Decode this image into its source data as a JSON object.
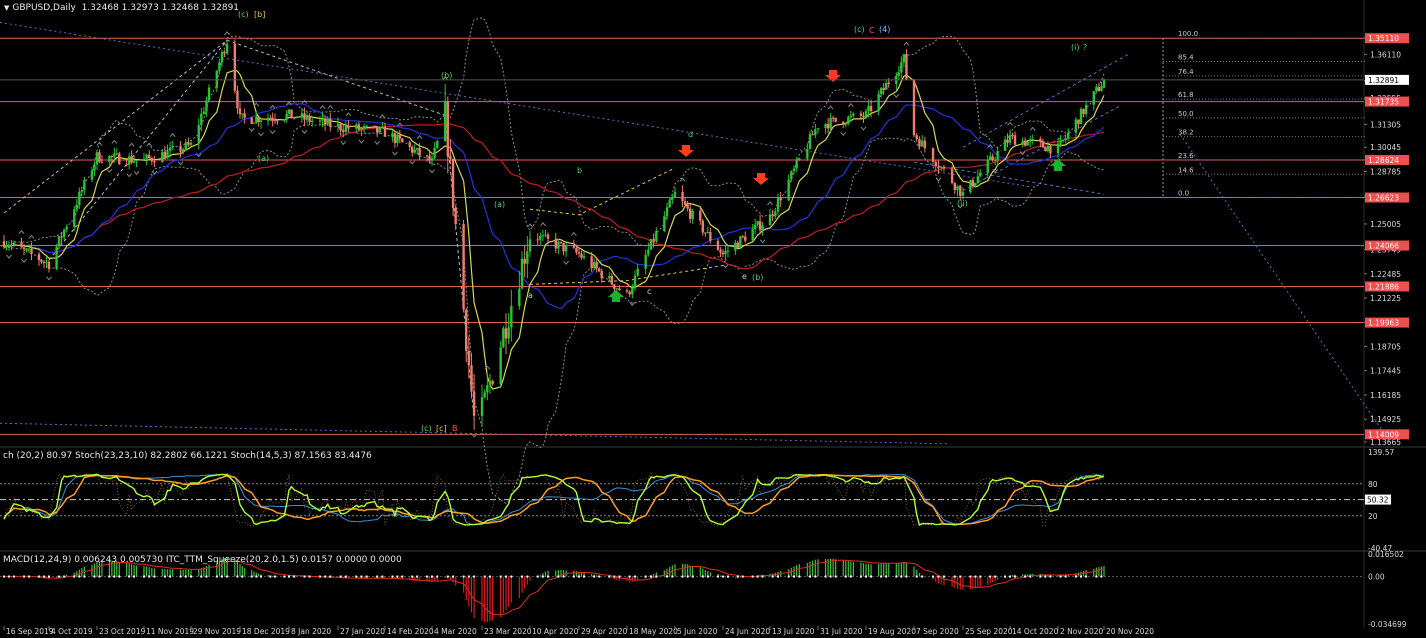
{
  "header": {
    "symbol_label": "GBPUSD,Daily",
    "ohlc": "1.32468 1.32973 1.32468 1.32891"
  },
  "colors": {
    "background": "#000000",
    "bull": "#29c431",
    "bear": "#f07c6c",
    "sr_line": "#e05d5d",
    "price_label_bg": "#ef4f4f",
    "last_price_bg": "#ffffff",
    "ma_yellow": "#d8d84a",
    "ma_blue": "#2233dd",
    "ma_red": "#c21e1e",
    "band": "#8c8c8c",
    "trend_blue": "#5a6fc0",
    "wave_green": "#4fd66a",
    "wave_red": "#ff5050",
    "fib": "#aaaaaa",
    "stoch_green": "#adff2f",
    "stoch_orange": "#ff9d1c",
    "stoch_blue": "#3a8fd8",
    "macd_green": "#40c040",
    "macd_red": "#e01919",
    "macd_signal": "#e0301e",
    "arrow_red": "#ff3c1f",
    "arrow_green": "#19b42c"
  },
  "axis": {
    "price_ticks": [
      "1.36110",
      "1.33802",
      "1.32555",
      "1.31305",
      "1.30045",
      "1.28785",
      "1.26525",
      "1.25005",
      "1.23745",
      "1.22485",
      "1.21225",
      "1.19965",
      "1.18705",
      "1.17445",
      "1.16185",
      "1.14925",
      "1.13665"
    ],
    "sr_labels": [
      "1.35110",
      "1.31735",
      "1.28624",
      "1.26623",
      "1.24066",
      "1.21886",
      "1.19963",
      "1.14009"
    ],
    "last_price": "1.32891",
    "date_labels": [
      "16 Sep 2019",
      "4 Oct 2019",
      "23 Oct 2019",
      "11 Nov 2019",
      "29 Nov 2019",
      "18 Dec 2019",
      "8 Jan 2020",
      "27 Jan 2020",
      "14 Feb 2020",
      "4 Mar 2020",
      "23 Mar 2020",
      "10 Apr 2020",
      "29 Apr 2020",
      "18 May 2020",
      "5 Jun 2020",
      "24 Jun 2020",
      "13 Jul 2020",
      "31 Jul 2020",
      "19 Aug 2020",
      "7 Sep 2020",
      "25 Sep 2020",
      "14 Oct 2020",
      "2 Nov 2020",
      "20 Nov 2020"
    ]
  },
  "fib_levels": [
    "100.0",
    "85.4",
    "76.4",
    "61.8",
    "50.0",
    "38.2",
    "23.6",
    "14.6",
    "0.0"
  ],
  "wave_labels": [
    "(c)",
    "[b]",
    "(b)",
    "(a)",
    "(a)",
    "b",
    "d",
    "a",
    "c",
    "e",
    "(b)",
    "(c)",
    "C",
    "(4)",
    "(i)",
    "?",
    "(ii)",
    "(c)",
    "[c]",
    "B"
  ],
  "stoch": {
    "header": "ch (20,2) 80.97  Stoch(23,23,10) 82.2802 66.1221  Stoch(14,5,3) 87.1563 83.4476",
    "axis_labels": [
      "139.57",
      "80",
      "50.32",
      "20",
      "-40.47"
    ]
  },
  "macd": {
    "header": "MACD(12,24,9) 0.006243 0.005730  ITC_TTM_Squeeze(20,2.0,1.5) 0.0157 0.0000 0.0000",
    "axis_labels": [
      "0.016502",
      "0.00",
      "-0.034699"
    ]
  },
  "chart_data": {
    "type": "candlestick",
    "symbol": "GBPUSD",
    "timeframe": "Daily",
    "x_range": [
      "16 Sep 2019",
      "20 Nov 2020"
    ],
    "ylim": [
      1.136,
      1.364
    ],
    "ohlc_last": {
      "open": 1.32468,
      "high": 1.32973,
      "low": 1.32468,
      "close": 1.32891
    },
    "close_path": [
      [
        "16 Sep 2019",
        1.243
      ],
      [
        "4 Oct 2019",
        1.231
      ],
      [
        "23 Oct 2019",
        1.288
      ],
      [
        "11 Nov 2019",
        1.286
      ],
      [
        "29 Nov 2019",
        1.294
      ],
      [
        "13 Dec 2019",
        1.35
      ],
      [
        "18 Dec 2019",
        1.308
      ],
      [
        "8 Jan 2020",
        1.31
      ],
      [
        "27 Jan 2020",
        1.304
      ],
      [
        "14 Feb 2020",
        1.301
      ],
      [
        "4 Mar 2020",
        1.285
      ],
      [
        "9 Mar 2020",
        1.31
      ],
      [
        "20 Mar 2020",
        1.148
      ],
      [
        "23 Mar 2020",
        1.152
      ],
      [
        "10 Apr 2020",
        1.247
      ],
      [
        "29 Apr 2020",
        1.236
      ],
      [
        "18 May 2020",
        1.214
      ],
      [
        "5 Jun 2020",
        1.268
      ],
      [
        "24 Jun 2020",
        1.236
      ],
      [
        "13 Jul 2020",
        1.256
      ],
      [
        "31 Jul 2020",
        1.305
      ],
      [
        "19 Aug 2020",
        1.31
      ],
      [
        "3 Sep 2020",
        1.34
      ],
      [
        "7 Sep 2020",
        1.3
      ],
      [
        "25 Sep 2020",
        1.268
      ],
      [
        "14 Oct 2020",
        1.298
      ],
      [
        "2 Nov 2020",
        1.292
      ],
      [
        "20 Nov 2020",
        1.3289
      ]
    ],
    "horizontal_levels": [
      1.3511,
      1.31735,
      1.28624,
      1.26623,
      1.24066,
      1.21886,
      1.19963,
      1.14009
    ],
    "stoch_ylim": [
      -40.47,
      139.57
    ],
    "stoch_levels": [
      80,
      50.32,
      20
    ],
    "macd_last": {
      "macd": 0.006243,
      "signal": 0.00573
    },
    "macd_ylim": [
      -0.034699,
      0.016502
    ]
  }
}
